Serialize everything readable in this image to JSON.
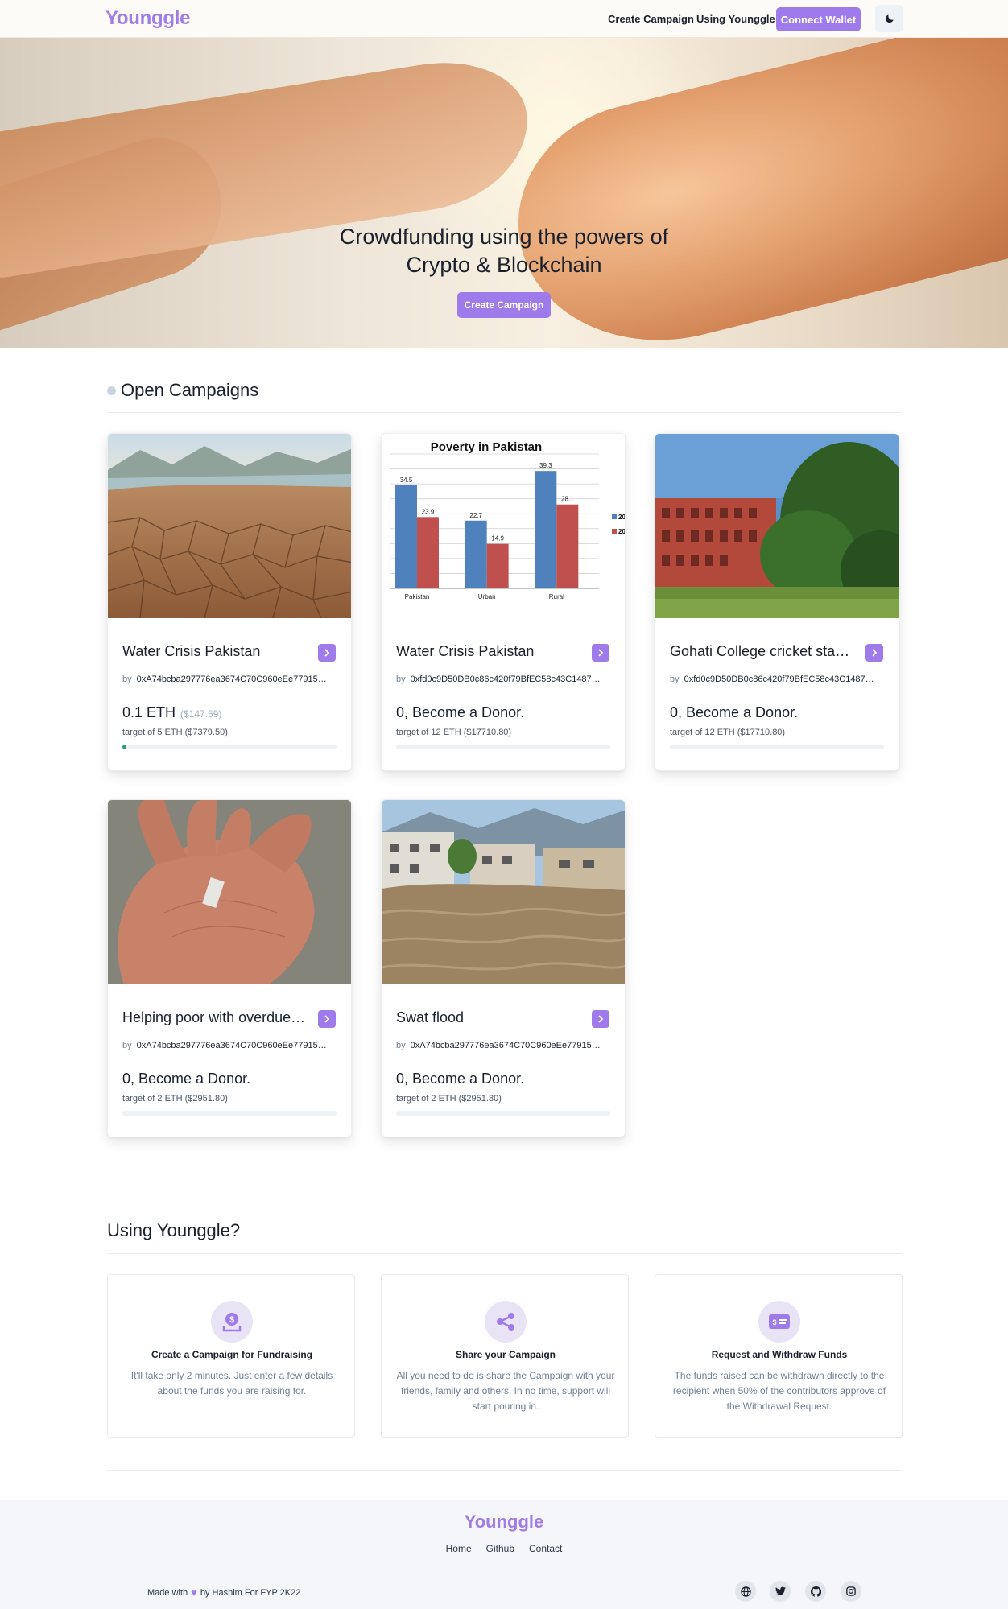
{
  "nav": {
    "brand": "Younggle",
    "links": [
      "Create Campaign",
      "Using Younggle"
    ],
    "connect_label": "Connect Wallet",
    "theme_icon": "moon-icon"
  },
  "hero": {
    "title_line1": "Crowdfunding using the powers of",
    "title_line2": "Crypto & Blockchain",
    "cta_label": "Create Campaign"
  },
  "campaigns": {
    "heading": "Open Campaigns",
    "by_label": "by",
    "items": [
      {
        "title": "Water Crisis Pakistan",
        "creator": "0xA74bcba297776ea3674C70C960eEe77915…",
        "amount": "0.1 ETH",
        "usd": "($147.59)",
        "target": "target of 5 ETH ($7379.50)",
        "progress": 0.02,
        "image": "cracked-dry-lakebed"
      },
      {
        "title": "Water Crisis Pakistan",
        "creator": "0xfd0c9D50DB0c86c420f79BfEC58c43C1487…",
        "amount": "0, Become a Donor.",
        "usd": "",
        "target": "target of 12 ETH ($17710.80)",
        "progress": 0,
        "image": "poverty-bar-chart",
        "image_chart": {
          "title": "Poverty in Pakistan",
          "categories": [
            "Pakistan",
            "Urban",
            "Rural"
          ],
          "series_a": [
            34.5,
            22.7,
            39.3
          ],
          "series_b": [
            23.9,
            14.9,
            28.1
          ],
          "legend": [
            "20",
            "20"
          ]
        }
      },
      {
        "title": "Gohati College cricket stadi…",
        "creator": "0xfd0c9D50DB0c86c420f79BfEC58c43C1487…",
        "amount": "0, Become a Donor.",
        "usd": "",
        "target": "target of 12 ETH ($17710.80)",
        "progress": 0,
        "image": "college-building-trees"
      },
      {
        "title": "Helping poor with overdue …",
        "creator": "0xA74bcba297776ea3674C70C960eEe77915…",
        "amount": "0, Become a Donor.",
        "usd": "",
        "target": "target of 2 ETH ($2951.80)",
        "progress": 0,
        "image": "hand-holding-coin"
      },
      {
        "title": "Swat flood",
        "creator": "0xA74bcba297776ea3674C70C960eEe77915…",
        "amount": "0, Become a Donor.",
        "usd": "",
        "target": "target of 2 ETH ($2951.80)",
        "progress": 0,
        "image": "flood-river-town"
      }
    ]
  },
  "using": {
    "heading": "Using Younggle?",
    "features": [
      {
        "icon": "dollar-upload-icon",
        "title": "Create a Campaign for Fundraising",
        "desc": "It'll take only 2 minutes. Just enter a few details about the funds you are raising for."
      },
      {
        "icon": "share-icon",
        "title": "Share your Campaign",
        "desc": "All you need to do is share the Campaign with your friends, family and others. In no time, support will start pouring in."
      },
      {
        "icon": "money-check-icon",
        "title": "Request and Withdraw Funds",
        "desc": "The funds raised can be withdrawn directly to the recipient when 50% of the contributors approve of the Withdrawal Request."
      }
    ]
  },
  "footer": {
    "brand": "Younggle",
    "links": [
      "Home",
      "Github",
      "Contact"
    ],
    "credit_prefix": "Made with",
    "credit_suffix": "by Hashim For FYP 2K22",
    "socials": [
      "globe-icon",
      "twitter-icon",
      "github-icon",
      "instagram-icon"
    ]
  },
  "colors": {
    "accent": "#9f7aea",
    "brand": "#a07ce4",
    "progress": "#2c9c8c"
  }
}
